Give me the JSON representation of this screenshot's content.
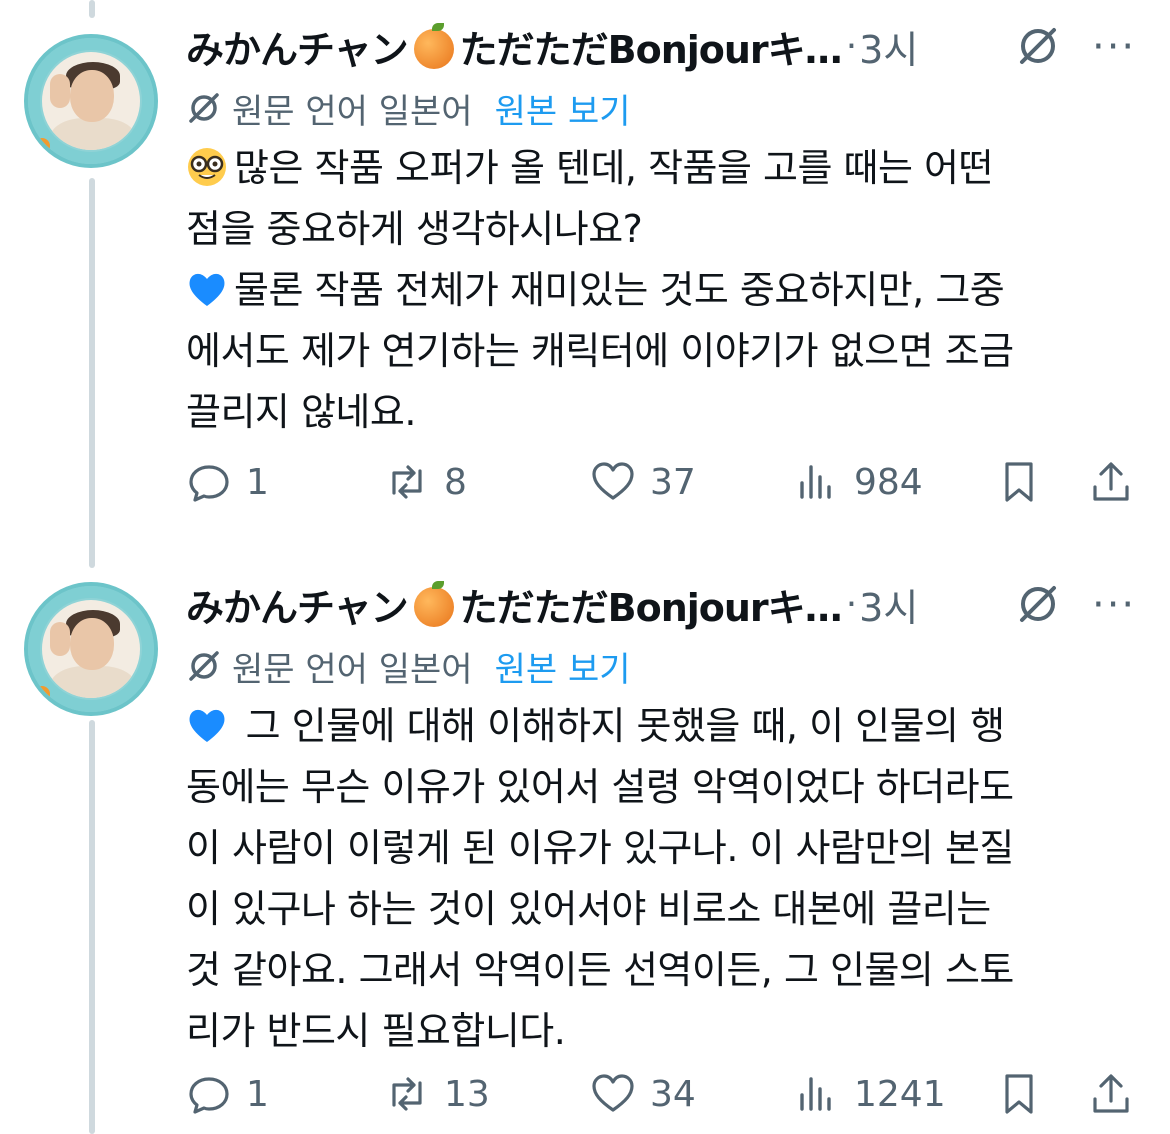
{
  "colors": {
    "text": "#0f1419",
    "muted": "#536471",
    "link": "#1d9bf0",
    "thread": "#cfd9de"
  },
  "tweets": [
    {
      "author_name": "みかんチャン",
      "author_name_2": "ただただBonjourキ…",
      "separator": "·",
      "time": "3시",
      "more": "···",
      "translation": {
        "lang_label": "원문 언어 일본어",
        "show_original": "원본 보기"
      },
      "lines": [
        "많은 작품 오퍼가 올 텐데, 작품을 고를 때는 어떤",
        "점을 중요하게 생각하시나요?",
        "물론 작품 전체가 재미있는 것도 중요하지만, 그중",
        "에서도 제가 연기하는 캐릭터에 이야기가 없으면 조금",
        "끌리지 않네요."
      ],
      "line_emojis": [
        "nerd-face-emoji",
        "",
        "blue-heart-emoji",
        "",
        ""
      ],
      "stats": {
        "replies": "1",
        "reposts": "8",
        "likes": "37",
        "views": "984"
      }
    },
    {
      "author_name": "みかんチャン",
      "author_name_2": "ただただBonjourキ…",
      "separator": "·",
      "time": "3시",
      "more": "···",
      "translation": {
        "lang_label": "원문 언어 일본어",
        "show_original": "원본 보기"
      },
      "lines": [
        " 그 인물에 대해 이해하지 못했을 때, 이 인물의 행",
        "동에는 무슨 이유가 있어서 설령 악역이었다 하더라도",
        "이 사람이 이렇게 된 이유가 있구나. 이 사람만의 본질",
        "이 있구나 하는 것이 있어서야 비로소 대본에 끌리는",
        "것 같아요. 그래서 악역이든 선역이든, 그 인물의 스토",
        "리가 반드시 필요합니다."
      ],
      "line_emojis": [
        "blue-heart-emoji",
        "",
        "",
        "",
        "",
        ""
      ],
      "stats": {
        "replies": "1",
        "reposts": "13",
        "likes": "34",
        "views": "1241"
      }
    }
  ]
}
